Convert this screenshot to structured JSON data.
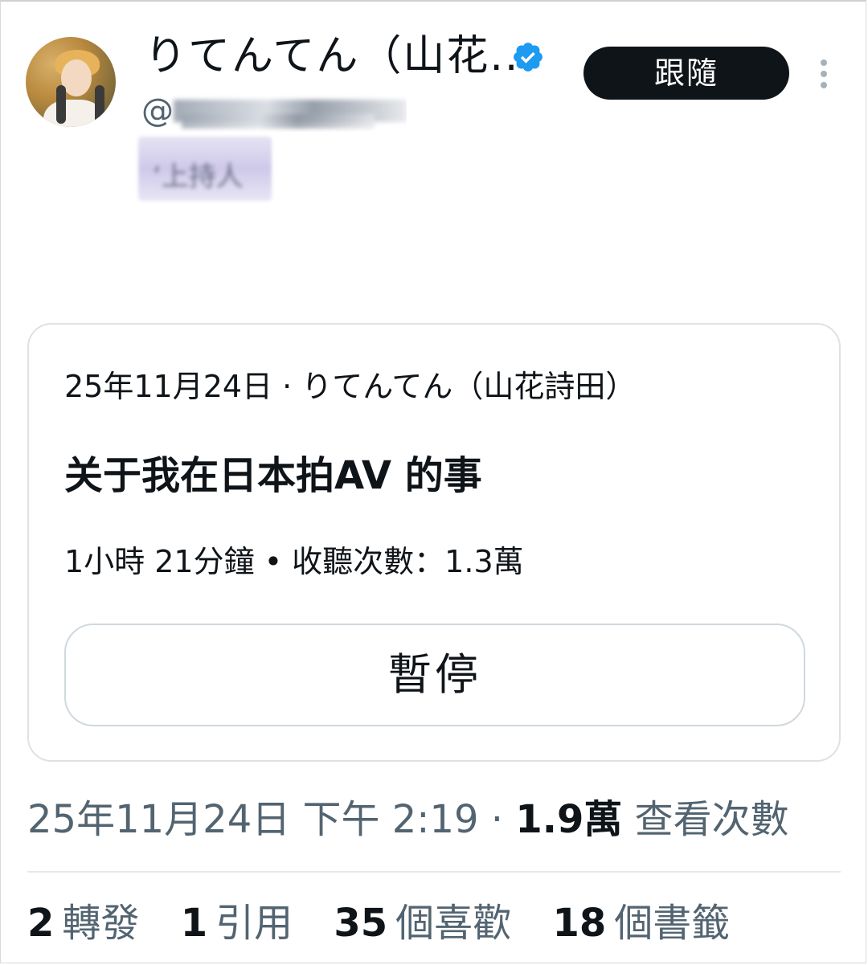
{
  "profile": {
    "display_name": "りてんてん（山花...",
    "handle": "@",
    "bio": "‘上持人",
    "follow_label": "跟隨"
  },
  "card": {
    "meta": "25年11月24日 · りてんてん（山花詩田）",
    "title": "关于我在日本拍AV 的事",
    "stats": "1小時 21分鐘 • 收聽次數：1.3萬",
    "pause_label": "暫停"
  },
  "post": {
    "timestamp": "25年11月24日 下午 2:19 · ",
    "views_count": "1.9萬",
    "views_label": " 查看次數"
  },
  "engagement": {
    "reposts_count": "2",
    "reposts_label": "轉發",
    "quotes_count": "1",
    "quotes_label": "引用",
    "likes_count": "35",
    "likes_label": "個喜歡",
    "bookmarks_count": "18",
    "bookmarks_label": "個書籤"
  },
  "colors": {
    "verified_badge": "#1d9bf0",
    "follow_button_bg": "#0f1419",
    "secondary_text": "#536471"
  },
  "icons": [
    "verified-badge-icon",
    "more-options-icon"
  ]
}
